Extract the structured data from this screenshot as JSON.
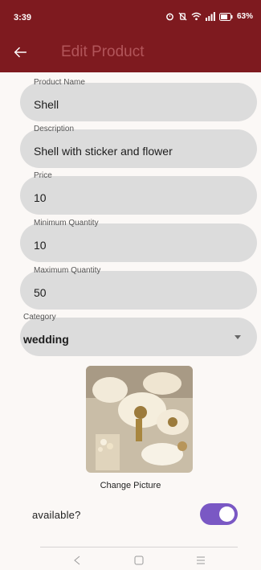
{
  "status_bar": {
    "time": "3:39",
    "battery": "63%",
    "icons": [
      "alarm-icon",
      "vibrate-off-icon",
      "wifi-icon",
      "signal-icon",
      "battery-icon"
    ]
  },
  "app_bar": {
    "title": "Edit Product",
    "back_icon": "arrow-left-icon",
    "background": "#7e1a1f"
  },
  "form": {
    "product_name": {
      "label": "Product Name",
      "value": "Shell"
    },
    "description": {
      "label": "Description",
      "value": "Shell with sticker and flower"
    },
    "price": {
      "label": "Price",
      "value": "10"
    },
    "min_quantity": {
      "label": "Minimum Quantity",
      "value": "10"
    },
    "max_quantity": {
      "label": "Maximum Quantity",
      "value": "50"
    },
    "category": {
      "label": "Category",
      "value": "wedding"
    }
  },
  "picture": {
    "change_label": "Change Picture"
  },
  "availability": {
    "label": "available?",
    "enabled": true,
    "accent": "#7a58c4"
  },
  "nav_bar": {
    "buttons": [
      "back-nav-icon",
      "home-nav-icon",
      "recents-nav-icon"
    ]
  }
}
